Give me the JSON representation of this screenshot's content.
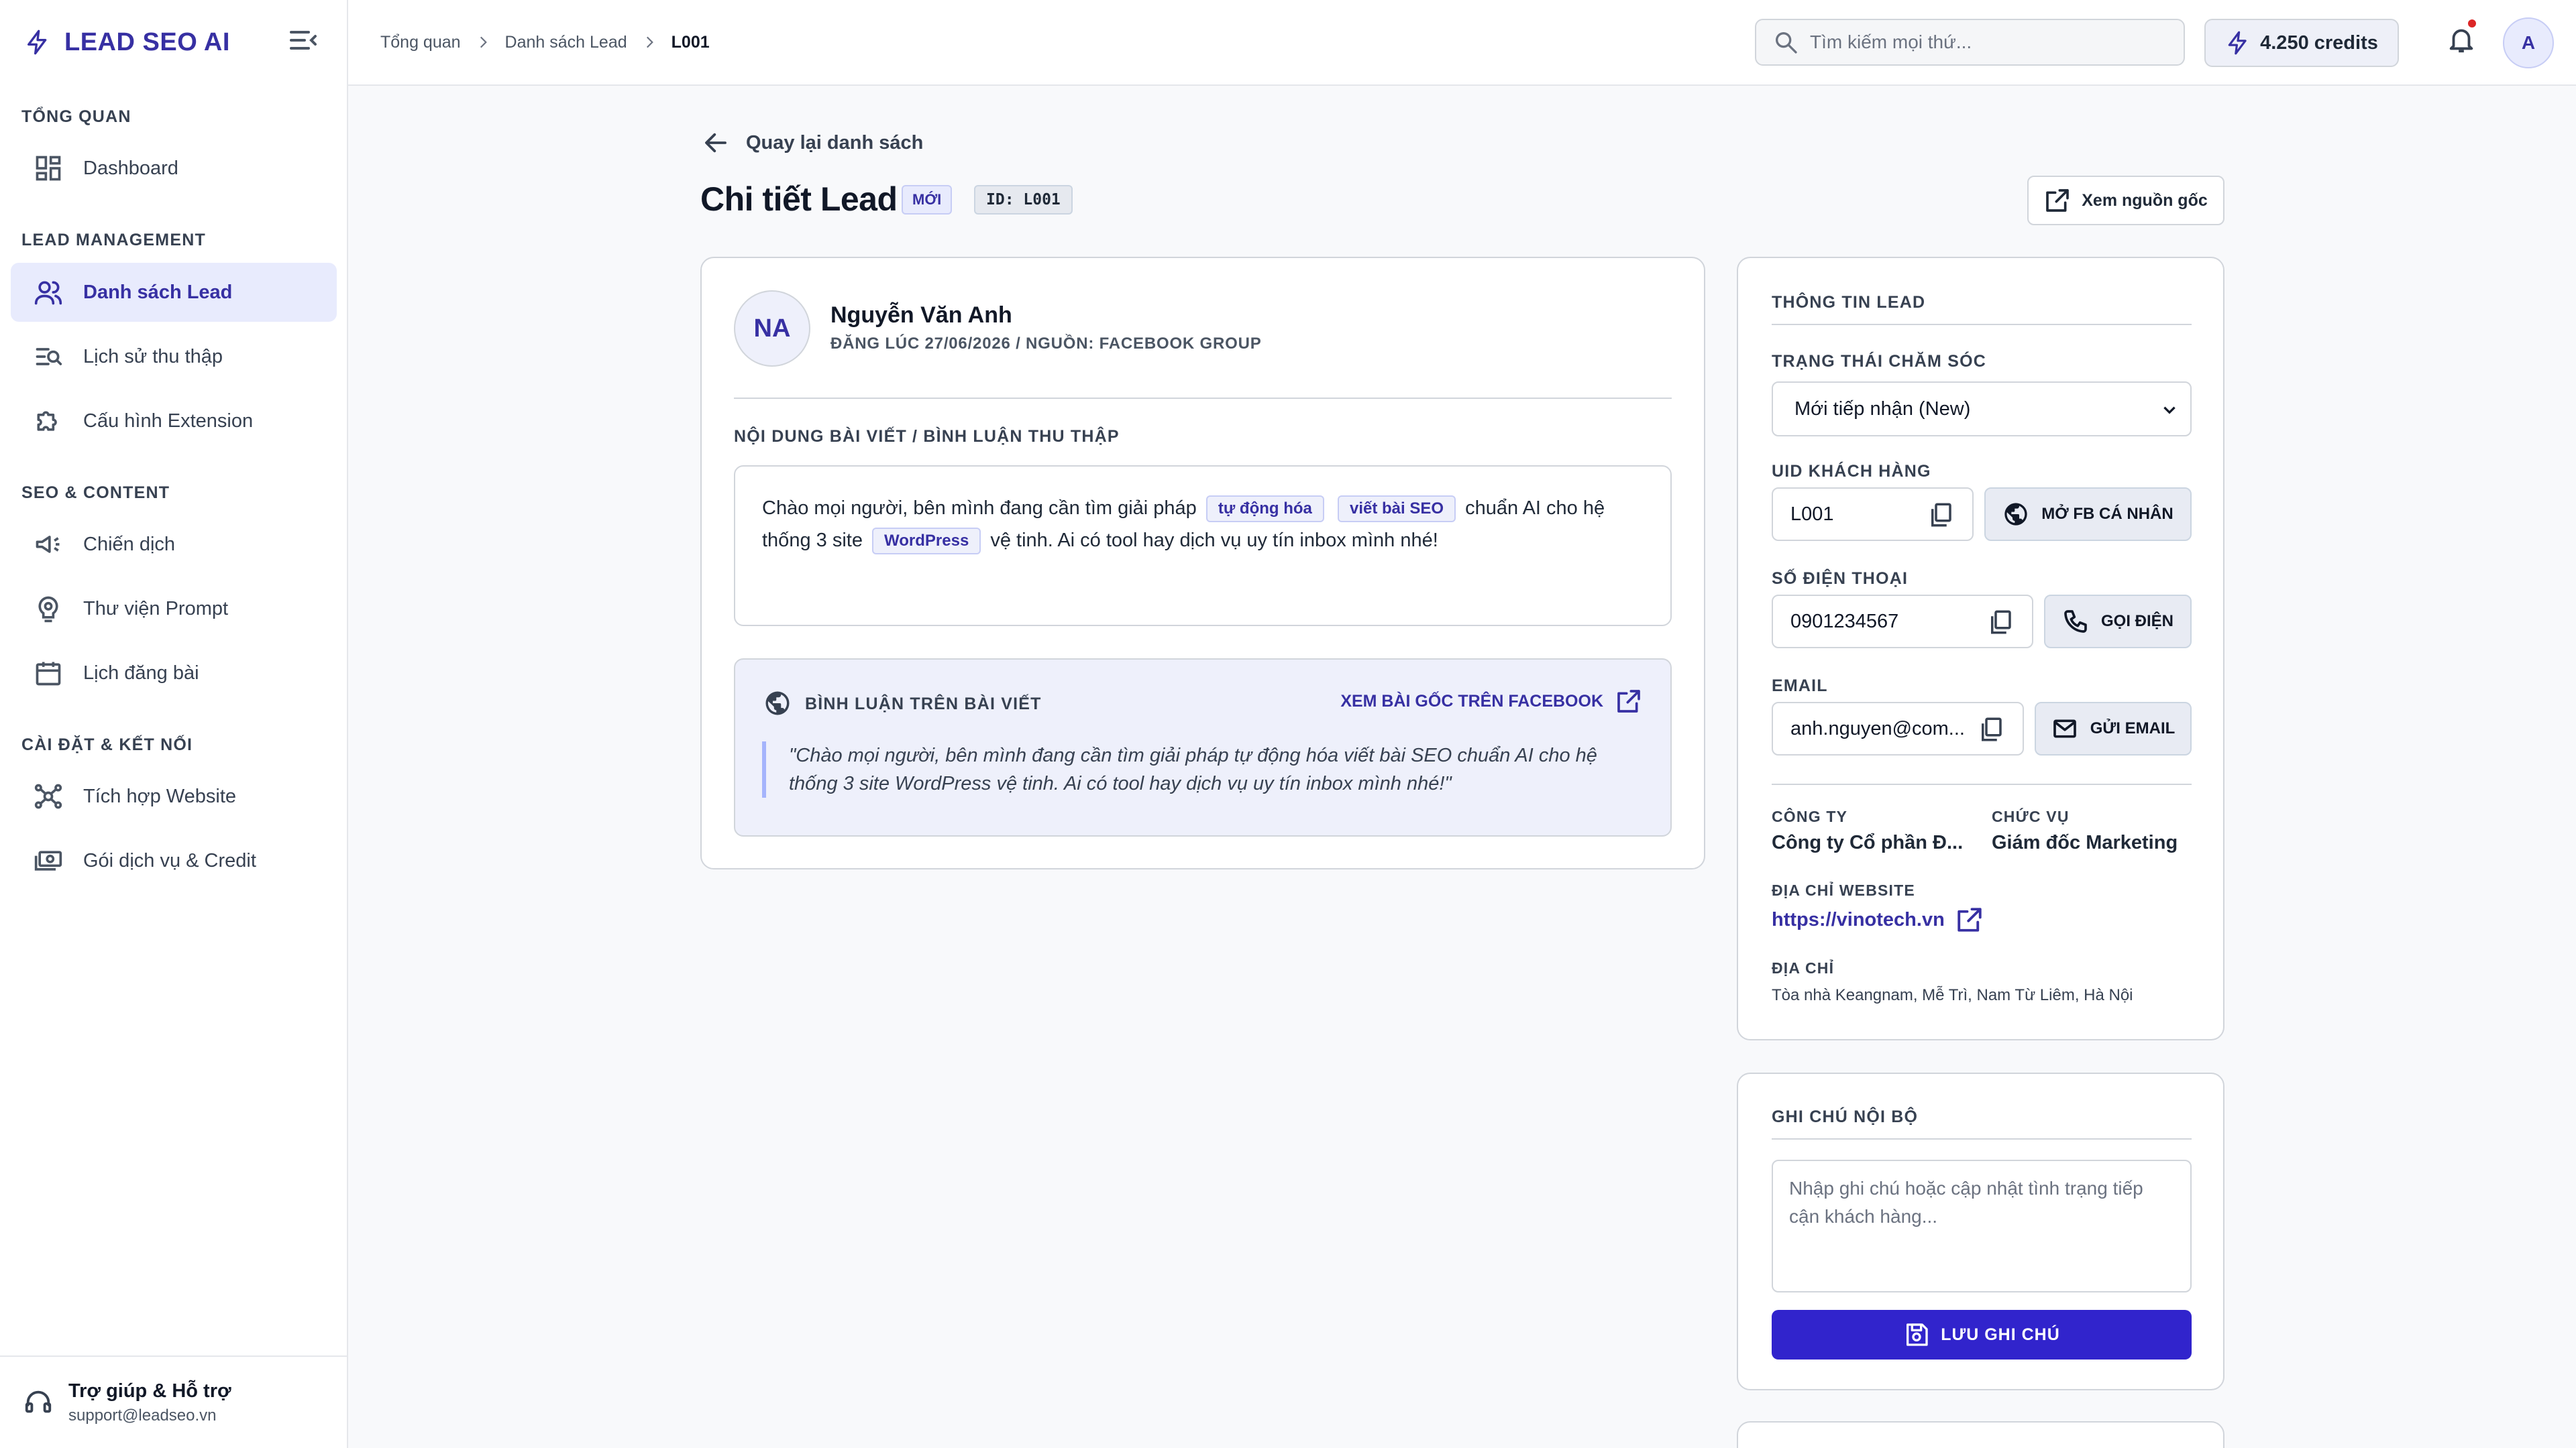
{
  "brand": {
    "name": "LEAD SEO AI"
  },
  "sidebar": {
    "groups": [
      {
        "title": "TỔNG QUAN"
      },
      {
        "title": "LEAD MANAGEMENT"
      },
      {
        "title": "SEO & CONTENT"
      },
      {
        "title": "CÀI ĐẶT & KẾT NỐI"
      }
    ],
    "items": [
      {
        "label": "Dashboard",
        "icon": "dashboard-icon"
      },
      {
        "label": "Danh sách Lead",
        "icon": "users-icon",
        "active": true
      },
      {
        "label": "Lịch sử thu thập",
        "icon": "search-list-icon"
      },
      {
        "label": "Cấu hình Extension",
        "icon": "puzzle-icon"
      },
      {
        "label": "Chiến dịch",
        "icon": "megaphone-icon"
      },
      {
        "label": "Thư viện Prompt",
        "icon": "brain-icon"
      },
      {
        "label": "Lịch đăng bài",
        "icon": "calendar-icon"
      },
      {
        "label": "Tích hợp Website",
        "icon": "hub-icon"
      },
      {
        "label": "Gói dịch vụ & Credit",
        "icon": "payments-icon"
      }
    ],
    "support": {
      "title": "Trợ giúp & Hỗ trợ",
      "email": "support@leadseo.vn"
    }
  },
  "topbar": {
    "breadcrumb": [
      "Tổng quan",
      "Danh sách Lead",
      "L001"
    ],
    "search_placeholder": "Tìm kiếm mọi thứ...",
    "credits": "4.250 credits",
    "avatar_initial": "A"
  },
  "page": {
    "back_label": "Quay lại danh sách",
    "title": "Chi tiết Lead",
    "status_badge": "MỚI",
    "id_badge": "ID: L001",
    "view_source_label": "Xem nguồn gốc"
  },
  "lead": {
    "initials": "NA",
    "name": "Nguyễn Văn Anh",
    "meta": "ĐĂNG LÚC 27/06/2026 / NGUỒN: FACEBOOK GROUP",
    "content_label": "NỘI DUNG BÀI VIẾT / BÌNH LUẬN THU THẬP",
    "post": {
      "part1": "Chào mọi người, bên mình đang cần tìm giải pháp",
      "kw1": "tự động hóa",
      "kw2": "viết bài SEO",
      "part2": "chuẩn AI cho hệ thống 3 site",
      "kw3": "WordPress",
      "part3": "vệ tinh. Ai có tool hay dịch vụ uy tín inbox mình nhé!"
    },
    "comment": {
      "heading": "BÌNH LUẬN TRÊN BÀI VIẾT",
      "link_label": "XEM BÀI GỐC TRÊN FACEBOOK",
      "quote": "\"Chào mọi người, bên mình đang cần tìm giải pháp tự động hóa viết bài SEO chuẩn AI cho hệ thống 3 site WordPress vệ tinh. Ai có tool hay dịch vụ uy tín inbox mình nhé!\""
    }
  },
  "info": {
    "title": "THÔNG TIN LEAD",
    "status_label": "TRẠNG THÁI CHĂM SÓC",
    "status_value": "Mới tiếp nhận (New)",
    "uid_label": "UID KHÁCH HÀNG",
    "uid_value": "L001",
    "uid_action": "MỞ FB CÁ NHÂN",
    "phone_label": "SỐ ĐIỆN THOẠI",
    "phone_value": "0901234567",
    "phone_action": "GỌI ĐIỆN",
    "email_label": "EMAIL",
    "email_value": "anh.nguyen@com...",
    "email_action": "GỬI EMAIL",
    "company_label": "CÔNG TY",
    "company_value": "Công ty Cổ phần Đ...",
    "position_label": "CHỨC VỤ",
    "position_value": "Giám đốc Marketing",
    "website_label": "ĐỊA CHỈ WEBSITE",
    "website_value": "https://vinotech.vn",
    "address_label": "ĐỊA CHỈ",
    "address_value": "Tòa nhà Keangnam, Mễ Trì, Nam Từ Liêm, Hà Nội"
  },
  "notes": {
    "title": "GHI CHÚ NỘI BỘ",
    "placeholder": "Nhập ghi chú hoặc cập nhật tình trạng tiếp cận khách hàng...",
    "save_label": "LƯU GHI CHÚ"
  },
  "colors": {
    "accent": "#3730a3",
    "primary_button": "#3124cc",
    "notification_dot": "#dc2626"
  }
}
